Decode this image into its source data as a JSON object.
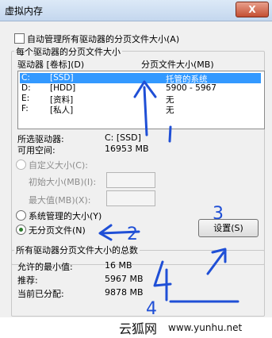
{
  "window": {
    "title": "虚拟内存",
    "close_label": "X"
  },
  "auto_manage": {
    "label": "自动管理所有驱动器的分页文件大小(A)",
    "checked": false
  },
  "per_drive_group": {
    "title": "每个驱动器的分页文件大小",
    "col_drive": "驱动器 [卷标](D)",
    "col_size": "分页文件大小(MB)",
    "rows": [
      {
        "drive": "C:",
        "label": "[SSD]",
        "size": "托管的系统",
        "selected": true
      },
      {
        "drive": "D:",
        "label": "[HDD]",
        "size": "5900 - 5967",
        "selected": false
      },
      {
        "drive": "E:",
        "label": "[资料]",
        "size": "无",
        "selected": false
      },
      {
        "drive": "F:",
        "label": "[私人]",
        "size": "无",
        "selected": false
      }
    ],
    "selected_drive_label": "所选驱动器:",
    "selected_drive_value": "C:  [SSD]",
    "available_space_label": "可用空间:",
    "available_space_value": "16953 MB",
    "custom_size_label": "自定义大小(C):",
    "initial_size_label": "初始大小(MB)(I):",
    "max_size_label": "最大值(MB)(X):",
    "system_managed_label": "系统管理的大小(Y)",
    "no_paging_label": "无分页文件(N)",
    "selected_option": "no_paging",
    "set_button_label": "设置(S)"
  },
  "totals_group": {
    "title": "所有驱动器分页文件大小的总数",
    "min_allowed_label": "允许的最小值:",
    "min_allowed_value": "16 MB",
    "recommended_label": "推荐:",
    "recommended_value": "5967 MB",
    "allocated_label": "当前已分配:",
    "allocated_value": "9878 MB"
  },
  "annotations": {
    "mark_2": "2",
    "mark_3": "3",
    "mark_4": "4",
    "annot_color": "#1f4fd6"
  },
  "watermark": {
    "logo": "云狐网",
    "url": "www.yunhu.net"
  }
}
